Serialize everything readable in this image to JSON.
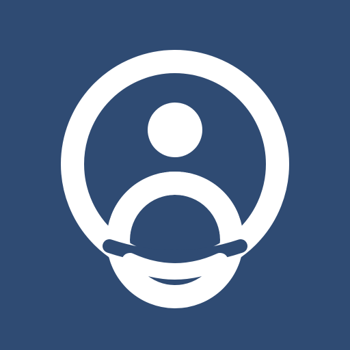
{
  "colors": {
    "background": "#2f4b73",
    "foreground": "#ffffff"
  },
  "icon": {
    "name": "user-profile-ring-icon"
  }
}
